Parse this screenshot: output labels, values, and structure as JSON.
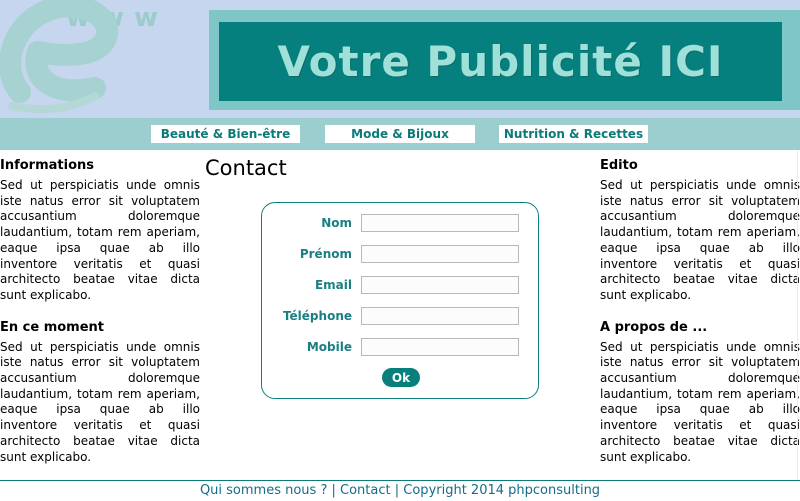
{
  "header": {
    "logo_icon": "e-www-logo-icon",
    "logo_text": "www",
    "banner_text": "Votre Publicité ICI"
  },
  "nav": {
    "items": [
      {
        "label": "Beauté & Bien-être"
      },
      {
        "label": "Mode & Bijoux"
      },
      {
        "label": "Nutrition & Recettes"
      }
    ]
  },
  "left_column": {
    "sections": [
      {
        "title": "Informations",
        "text": "Sed ut perspiciatis unde omnis iste natus error sit voluptatem accusantium doloremque laudantium, totam rem aperiam, eaque ipsa quae ab illo inventore veritatis et quasi architecto beatae vitae dicta sunt explicabo."
      },
      {
        "title": "En ce moment",
        "text": "Sed ut perspiciatis unde omnis iste natus error sit voluptatem accusantium doloremque laudantium, totam rem aperiam, eaque ipsa quae ab illo inventore veritatis et quasi architecto beatae vitae dicta sunt explicabo."
      }
    ]
  },
  "right_column": {
    "sections": [
      {
        "title": "Edito",
        "text": "Sed ut perspiciatis unde omnis iste natus error sit voluptatem accusantium doloremque laudantium, totam rem aperiam, eaque ipsa quae ab illo inventore veritatis et quasi architecto beatae vitae dicta sunt explicabo."
      },
      {
        "title": "A propos de ...",
        "text": "Sed ut perspiciatis unde omnis iste natus error sit voluptatem accusantium doloremque laudantium, totam rem aperiam, eaque ipsa quae ab illo inventore veritatis et quasi architecto beatae vitae dicta sunt explicabo."
      }
    ]
  },
  "main": {
    "title": "Contact",
    "form": {
      "fields": [
        {
          "label": "Nom",
          "value": "",
          "placeholder": ""
        },
        {
          "label": "Prénom",
          "value": "",
          "placeholder": ""
        },
        {
          "label": "Email",
          "value": "",
          "placeholder": ""
        },
        {
          "label": "Téléphone",
          "value": "",
          "placeholder": ""
        },
        {
          "label": "Mobile",
          "value": "",
          "placeholder": ""
        }
      ],
      "submit_label": "Ok"
    }
  },
  "footer": {
    "about_link": "Qui sommes nous ?",
    "separator": "|",
    "contact_link": "Contact",
    "copyright": "Copyright 2014 phpconsulting"
  },
  "colors": {
    "header_bg": "#c5d6ee",
    "banner_bg": "#05807e",
    "banner_text": "#9fe0d8",
    "nav_bg": "#9ccecf",
    "accent": "#0a7b78",
    "footer_link": "#136d8a"
  }
}
